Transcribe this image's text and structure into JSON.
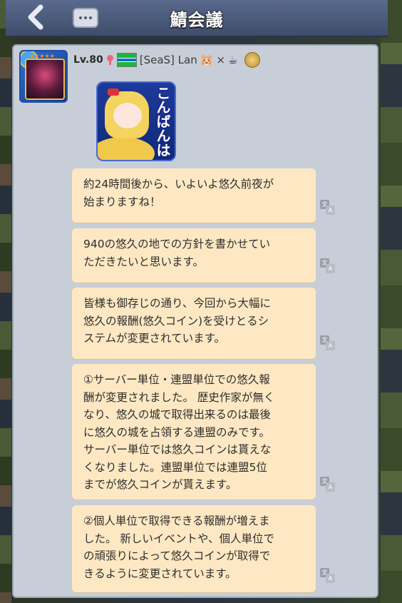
{
  "header": {
    "title": "鯖会議",
    "back_icon": "chevron-left-icon",
    "menu_icon": "more-dots-icon"
  },
  "post": {
    "level": "Lv.80",
    "player_name": "[SeaS] Lan",
    "name_suffix": "×",
    "sticker_text": "こんばんは",
    "messages": [
      "約24時間後から、いよいよ悠久前夜が\n始まりますね！",
      "940の悠久の地での方針を書かせてい\nただきたいと思います。",
      "皆様も御存じの通り、今回から大幅に\n悠久の報酬(悠久コイン)を受けとるシ\nステムが変更されています。",
      "①サーバー単位・連盟単位での悠久報\n酬が変更されました。 歴史作家が無く\nなり、悠久の城で取得出来るのは最後\nに悠久の城を占領する連盟のみです。\nサーバー単位では悠久コインは貰えな\nくなりました。連盟単位では連盟5位\nまでが悠久コインが貰えます。",
      "②個人単位で取得できる報酬が増えま\nした。 新しいイベントや、個人単位で\nの頑張りによって悠久コインが取得で\nきるように変更されています。"
    ],
    "translate_label_a": "文",
    "translate_label_b": "A"
  },
  "colors": {
    "bubble": "#fde8c3",
    "panel": "#c8ced8",
    "titlebar": "#4a5878"
  }
}
